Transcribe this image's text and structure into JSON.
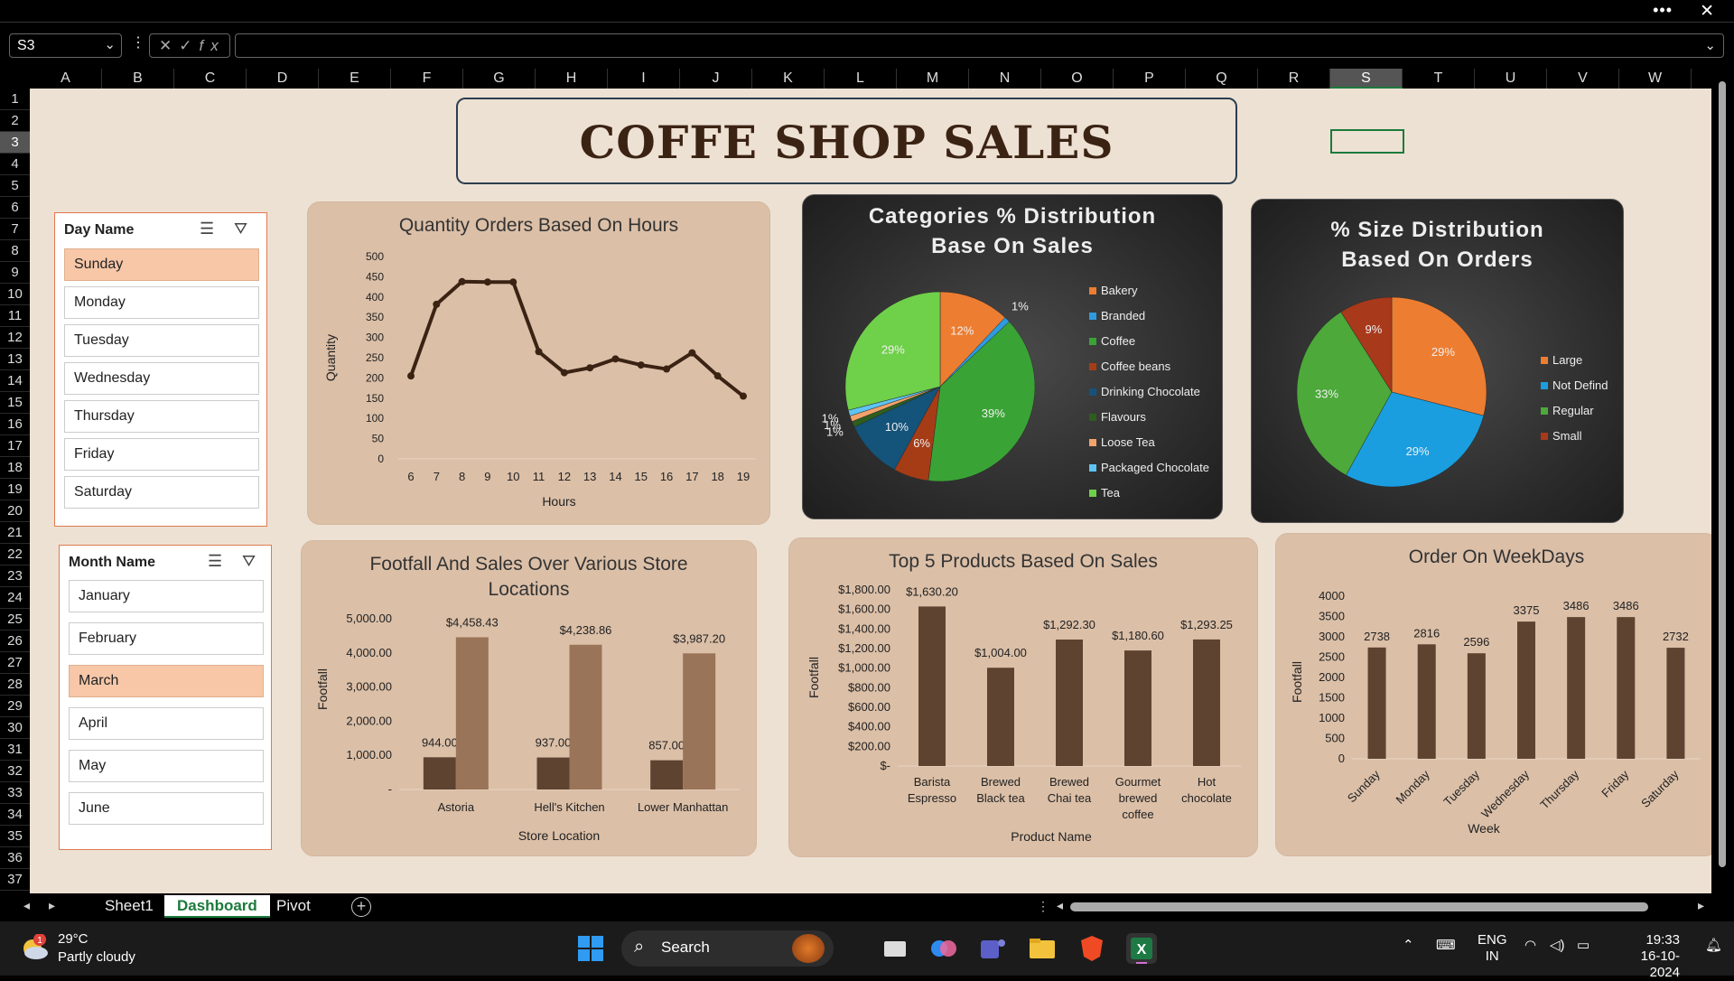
{
  "namebox": {
    "value": "S3"
  },
  "formula": {
    "fx": "fx"
  },
  "columns": [
    "A",
    "B",
    "C",
    "D",
    "E",
    "F",
    "G",
    "H",
    "I",
    "J",
    "K",
    "L",
    "M",
    "N",
    "O",
    "P",
    "Q",
    "R",
    "S",
    "T",
    "U",
    "V",
    "W"
  ],
  "selected_column": "S",
  "rows": [
    "1",
    "2",
    "3",
    "4",
    "5",
    "6",
    "7",
    "8",
    "9",
    "10",
    "11",
    "12",
    "13",
    "14",
    "15",
    "16",
    "17",
    "18",
    "19",
    "20",
    "21",
    "22",
    "23",
    "24",
    "25",
    "26",
    "27",
    "28",
    "29",
    "30",
    "31",
    "32",
    "33",
    "34",
    "35",
    "36",
    "37"
  ],
  "selected_row": "3",
  "title": "COFFE SHOP SALES",
  "day_slicer": {
    "header": "Day Name",
    "items": [
      "Sunday",
      "Monday",
      "Tuesday",
      "Wednesday",
      "Thursday",
      "Friday",
      "Saturday"
    ],
    "selected": "Sunday"
  },
  "month_slicer": {
    "header": "Month Name",
    "items": [
      "January",
      "February",
      "March",
      "April",
      "May",
      "June"
    ],
    "selected": "March"
  },
  "charts": {
    "hours": {
      "title": "Quantity Orders Based On Hours"
    },
    "categories": {
      "title_line1": "Categories % Distribution",
      "title_line2": "Base On Sales"
    },
    "size": {
      "title_line1": "% Size Distribution",
      "title_line2": "Based On Orders"
    },
    "footfall": {
      "title_line1": "Footfall And Sales Over Various Store",
      "title_line2": "Locations"
    },
    "products": {
      "title": "Top  5 Products Based On Sales"
    },
    "weekdays": {
      "title": "Order On WeekDays"
    }
  },
  "chart_data": [
    {
      "type": "line",
      "title": "Quantity Orders Based On Hours",
      "xlabel": "Hours",
      "ylabel": "Quantity",
      "x": [
        6,
        7,
        8,
        9,
        10,
        11,
        12,
        13,
        14,
        15,
        16,
        17,
        18,
        19
      ],
      "values": [
        205,
        382,
        438,
        437,
        437,
        265,
        213,
        225,
        247,
        232,
        222,
        262,
        205,
        155
      ],
      "ylim": [
        0,
        500
      ],
      "yticks": [
        0,
        50,
        100,
        150,
        200,
        250,
        300,
        350,
        400,
        450,
        500
      ],
      "color": "#3b2314"
    },
    {
      "type": "pie",
      "title": "Categories % Distribution Base On Sales",
      "slices": [
        {
          "label": "Bakery",
          "pct": 12,
          "text": "12%",
          "color": "#ed7d31"
        },
        {
          "label": "Branded",
          "pct": 1,
          "text": "1%",
          "color": "#2e9be0"
        },
        {
          "label": "Coffee",
          "pct": 39,
          "text": "39%",
          "color": "#3aa336"
        },
        {
          "label": "Coffee beans",
          "pct": 6,
          "text": "6%",
          "color": "#a63c16"
        },
        {
          "label": "Drinking Chocolate",
          "pct": 10,
          "text": "10%",
          "color": "#14537a"
        },
        {
          "label": "Flavours",
          "pct": 1,
          "text": "1%",
          "color": "#2e5e1d"
        },
        {
          "label": "Loose Tea",
          "pct": 1,
          "text": "1%",
          "color": "#f2a36b"
        },
        {
          "label": "Packaged Chocolate",
          "pct": 1,
          "text": "1%",
          "color": "#5ec4f2"
        },
        {
          "label": "Tea",
          "pct": 29,
          "text": "29%",
          "color": "#6fd04a"
        }
      ],
      "legend": "right"
    },
    {
      "type": "pie",
      "title": "% Size Distribution Based On Orders",
      "slices": [
        {
          "label": "Large",
          "pct": 29,
          "text": "29%",
          "color": "#ed7d31"
        },
        {
          "label": "Not Defind",
          "pct": 29,
          "text": "29%",
          "color": "#1a9ee0"
        },
        {
          "label": "Regular",
          "pct": 33,
          "text": "33%",
          "color": "#4ca93a"
        },
        {
          "label": "Small",
          "pct": 9,
          "text": "9%",
          "color": "#a8391b"
        }
      ],
      "legend": "right"
    },
    {
      "type": "bar",
      "title": "Footfall And Sales Over Various Store Locations",
      "xlabel": "Store Location",
      "ylabel": "Footfall",
      "categories": [
        "Astoria",
        "Hell's Kitchen",
        "Lower Manhattan"
      ],
      "series": [
        {
          "values": [
            944,
            937,
            857
          ],
          "labels": [
            "944.00",
            "937.00",
            "857.00"
          ],
          "color": "#5e4430"
        },
        {
          "values": [
            4458.43,
            4238.86,
            3987.2
          ],
          "labels": [
            "$4,458.43",
            "$4,238.86",
            "$3,987.20"
          ],
          "color": "#9a7458"
        }
      ],
      "ylim": [
        0,
        5000
      ],
      "yticks": [
        "-",
        "1,000.00",
        "2,000.00",
        "3,000.00",
        "4,000.00",
        "5,000.00"
      ]
    },
    {
      "type": "bar",
      "title": "Top  5 Products Based On Sales",
      "xlabel": "Product Name",
      "ylabel": "Footfall",
      "categories": [
        "Barista Espresso",
        "Brewed Black tea",
        "Brewed Chai tea",
        "Gourmet brewed coffee",
        "Hot chocolate"
      ],
      "category_lines": [
        [
          "Barista",
          "Espresso"
        ],
        [
          "Brewed",
          "Black tea"
        ],
        [
          "Brewed",
          "Chai tea"
        ],
        [
          "Gourmet",
          "brewed",
          "coffee"
        ],
        [
          "Hot",
          "chocolate"
        ]
      ],
      "values": [
        1630.2,
        1004.0,
        1292.3,
        1180.6,
        1293.25
      ],
      "labels": [
        "$1,630.20",
        "$1,004.00",
        "$1,292.30",
        "$1,180.60",
        "$1,293.25"
      ],
      "ylim": [
        0,
        1800
      ],
      "yticks": [
        "$-",
        "$200.00",
        "$400.00",
        "$600.00",
        "$800.00",
        "$1,000.00",
        "$1,200.00",
        "$1,400.00",
        "$1,600.00",
        "$1,800.00"
      ],
      "color": "#5e4430"
    },
    {
      "type": "bar",
      "title": "Order On WeekDays",
      "xlabel": "Week",
      "ylabel": "Footfall",
      "categories": [
        "Sunday",
        "Monday",
        "Tuesday",
        "Wednesday",
        "Thursday",
        "Friday",
        "Saturday"
      ],
      "values": [
        2738,
        2816,
        2596,
        3375,
        3486,
        3486,
        2732
      ],
      "ylim": [
        0,
        4000
      ],
      "yticks": [
        "0",
        "500",
        "1000",
        "1500",
        "2000",
        "2500",
        "3000",
        "3500",
        "4000"
      ],
      "color": "#5e4430"
    }
  ],
  "sheet_tabs": {
    "items": [
      "Sheet1",
      "Dashboard",
      "Pivot"
    ],
    "active": "Dashboard"
  },
  "taskbar": {
    "weather_temp": "29°C",
    "weather_desc": "Partly cloudy",
    "weather_badge": "1",
    "search_label": "Search",
    "lang": "ENG",
    "region": "IN",
    "time": "19:33",
    "date": "16-10-2024"
  }
}
